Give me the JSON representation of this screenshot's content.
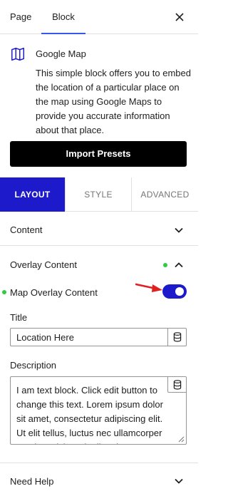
{
  "tabs": {
    "page": "Page",
    "block": "Block"
  },
  "block": {
    "title": "Google Map",
    "description": "This simple block offers you to embed the location of a particular place on the map using Google Maps to provide you accurate information about that place."
  },
  "import_button": "Import Presets",
  "panel_tabs": {
    "layout": "LAYOUT",
    "style": "STYLE",
    "advanced": "ADVANCED"
  },
  "sections": {
    "content": "Content",
    "overlay_content": "Overlay Content",
    "need_help": "Need Help"
  },
  "overlay": {
    "toggle_label": "Map Overlay Content",
    "toggle_on": true,
    "title_label": "Title",
    "title_value": "Location Here",
    "description_label": "Description",
    "description_value": "I am text block. Click edit button to change this text. Lorem ipsum dolor sit amet, consectetur adipiscing elit. Ut elit tellus, luctus nec ullamcorper mattis, pulvinar dapibus leo."
  },
  "colors": {
    "accent": "#1d1acb",
    "indicator": "#2ecc40",
    "arrow": "#e02020",
    "tab_underline": "#3858e9"
  }
}
